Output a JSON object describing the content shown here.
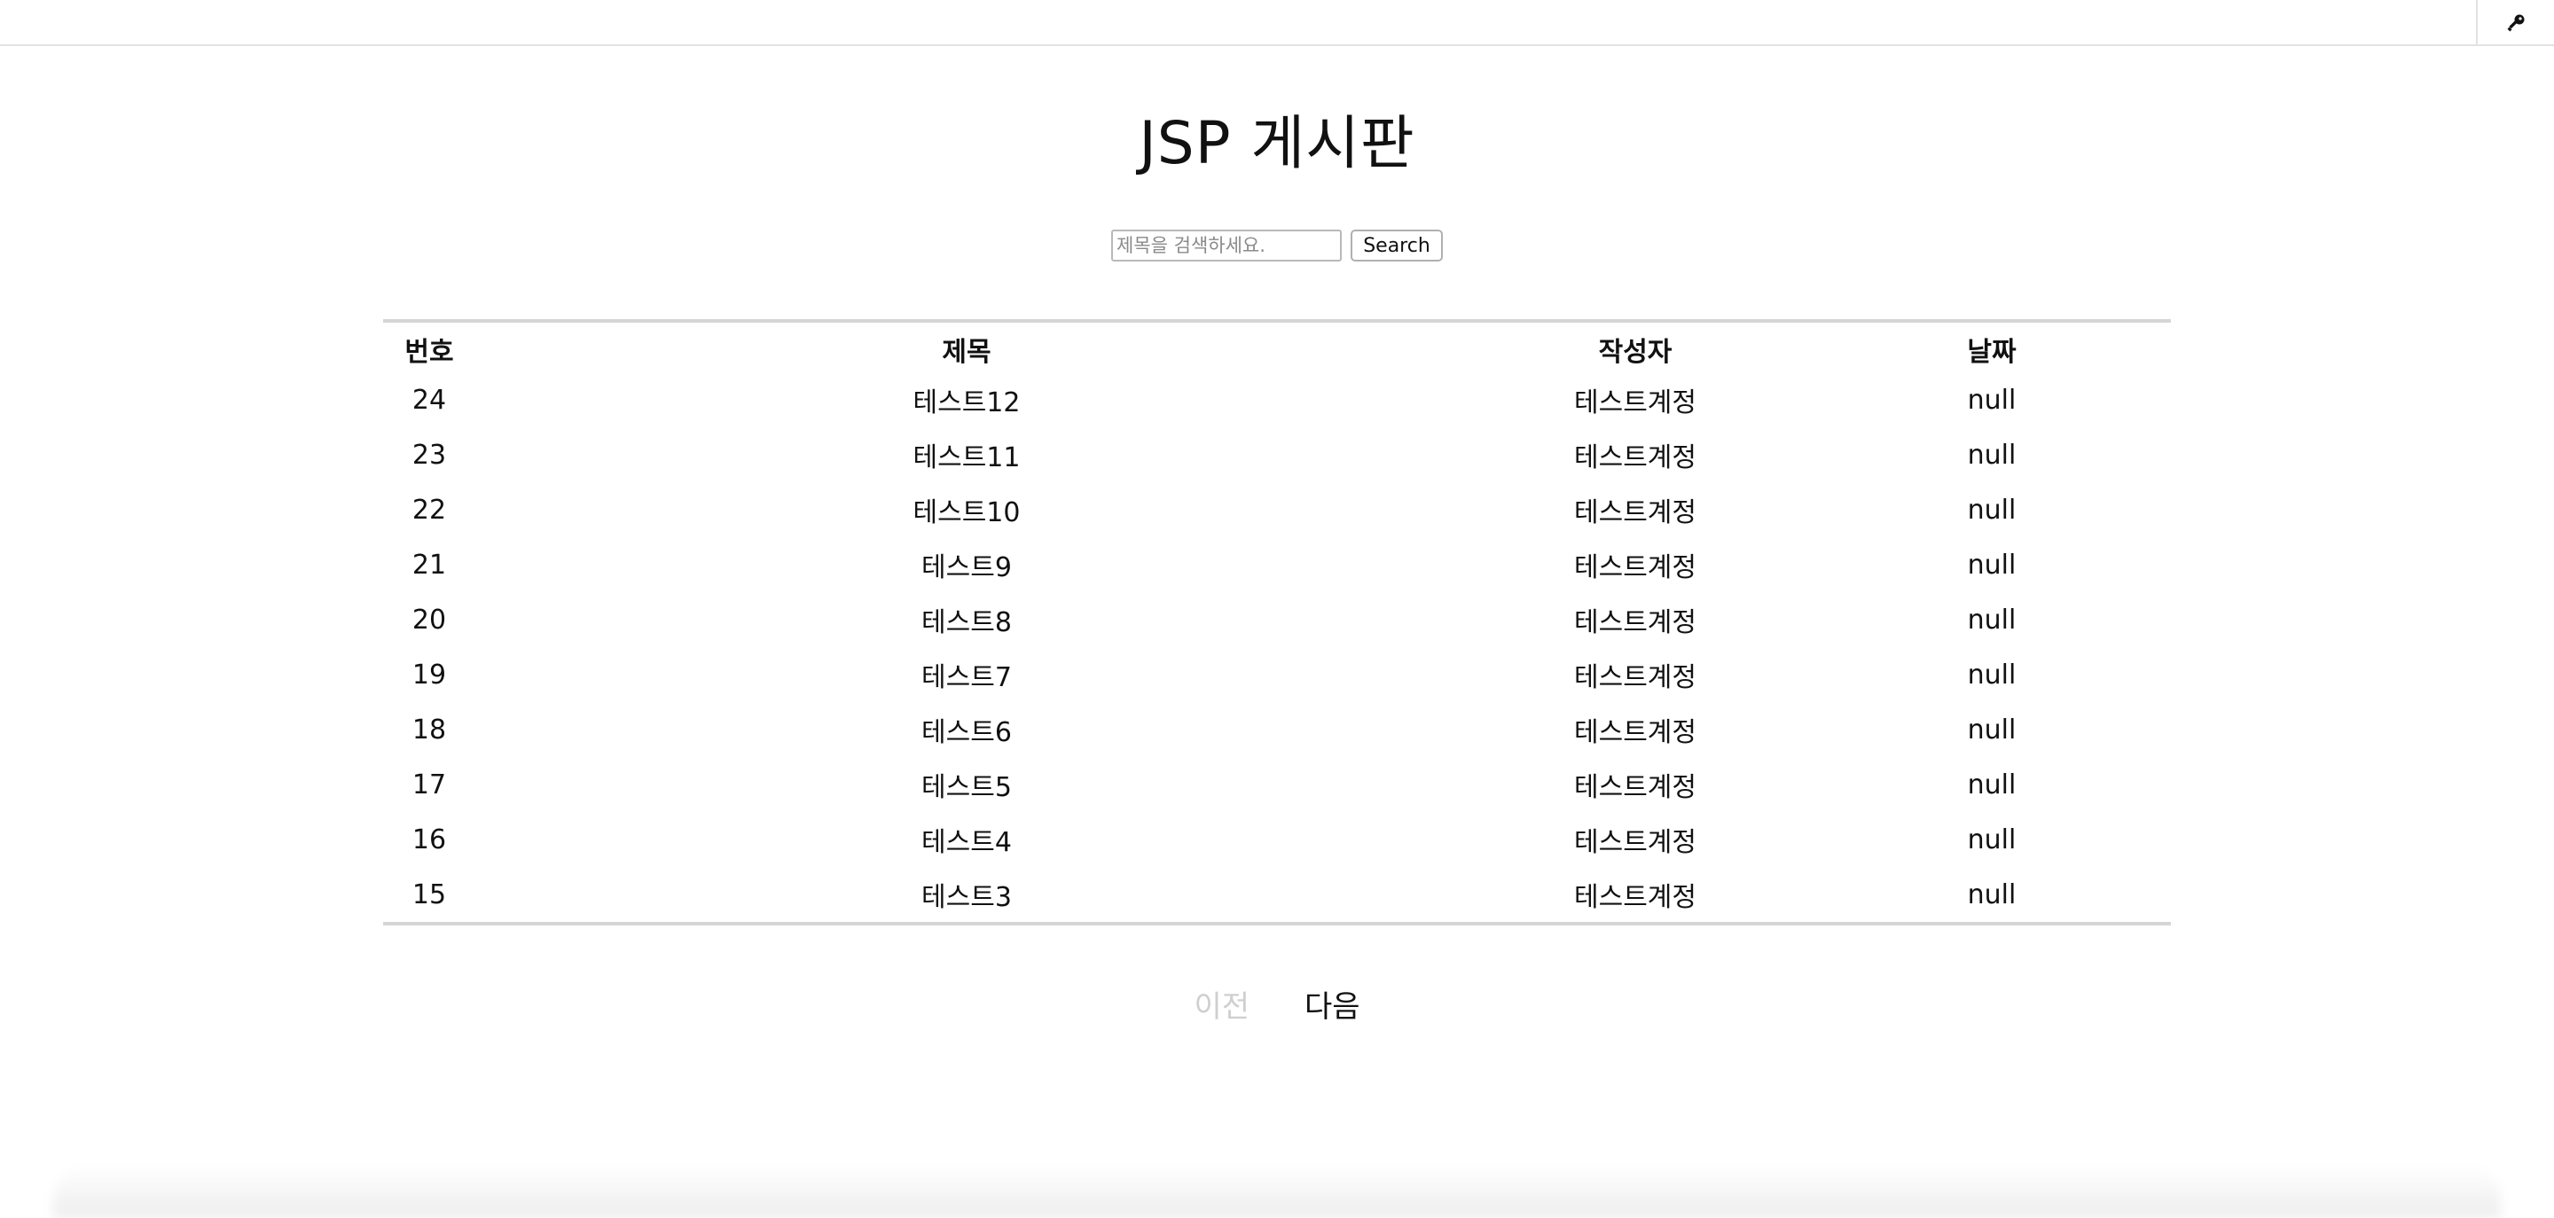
{
  "header": {
    "key_icon": "key-icon"
  },
  "page": {
    "title": "JSP 게시판"
  },
  "search": {
    "placeholder": "제목을 검색하세요.",
    "value": "",
    "button_label": "Search"
  },
  "table": {
    "headers": {
      "no": "번호",
      "title": "제목",
      "author": "작성자",
      "date": "날짜"
    },
    "rows": [
      {
        "no": "24",
        "title": "테스트12",
        "author": "테스트계정",
        "date": "null"
      },
      {
        "no": "23",
        "title": "테스트11",
        "author": "테스트계정",
        "date": "null"
      },
      {
        "no": "22",
        "title": "테스트10",
        "author": "테스트계정",
        "date": "null"
      },
      {
        "no": "21",
        "title": "테스트9",
        "author": "테스트계정",
        "date": "null"
      },
      {
        "no": "20",
        "title": "테스트8",
        "author": "테스트계정",
        "date": "null"
      },
      {
        "no": "19",
        "title": "테스트7",
        "author": "테스트계정",
        "date": "null"
      },
      {
        "no": "18",
        "title": "테스트6",
        "author": "테스트계정",
        "date": "null"
      },
      {
        "no": "17",
        "title": "테스트5",
        "author": "테스트계정",
        "date": "null"
      },
      {
        "no": "16",
        "title": "테스트4",
        "author": "테스트계정",
        "date": "null"
      },
      {
        "no": "15",
        "title": "테스트3",
        "author": "테스트계정",
        "date": "null"
      }
    ]
  },
  "pagination": {
    "prev_label": "이전",
    "next_label": "다음",
    "prev_disabled_color": "#cfcfcf"
  }
}
